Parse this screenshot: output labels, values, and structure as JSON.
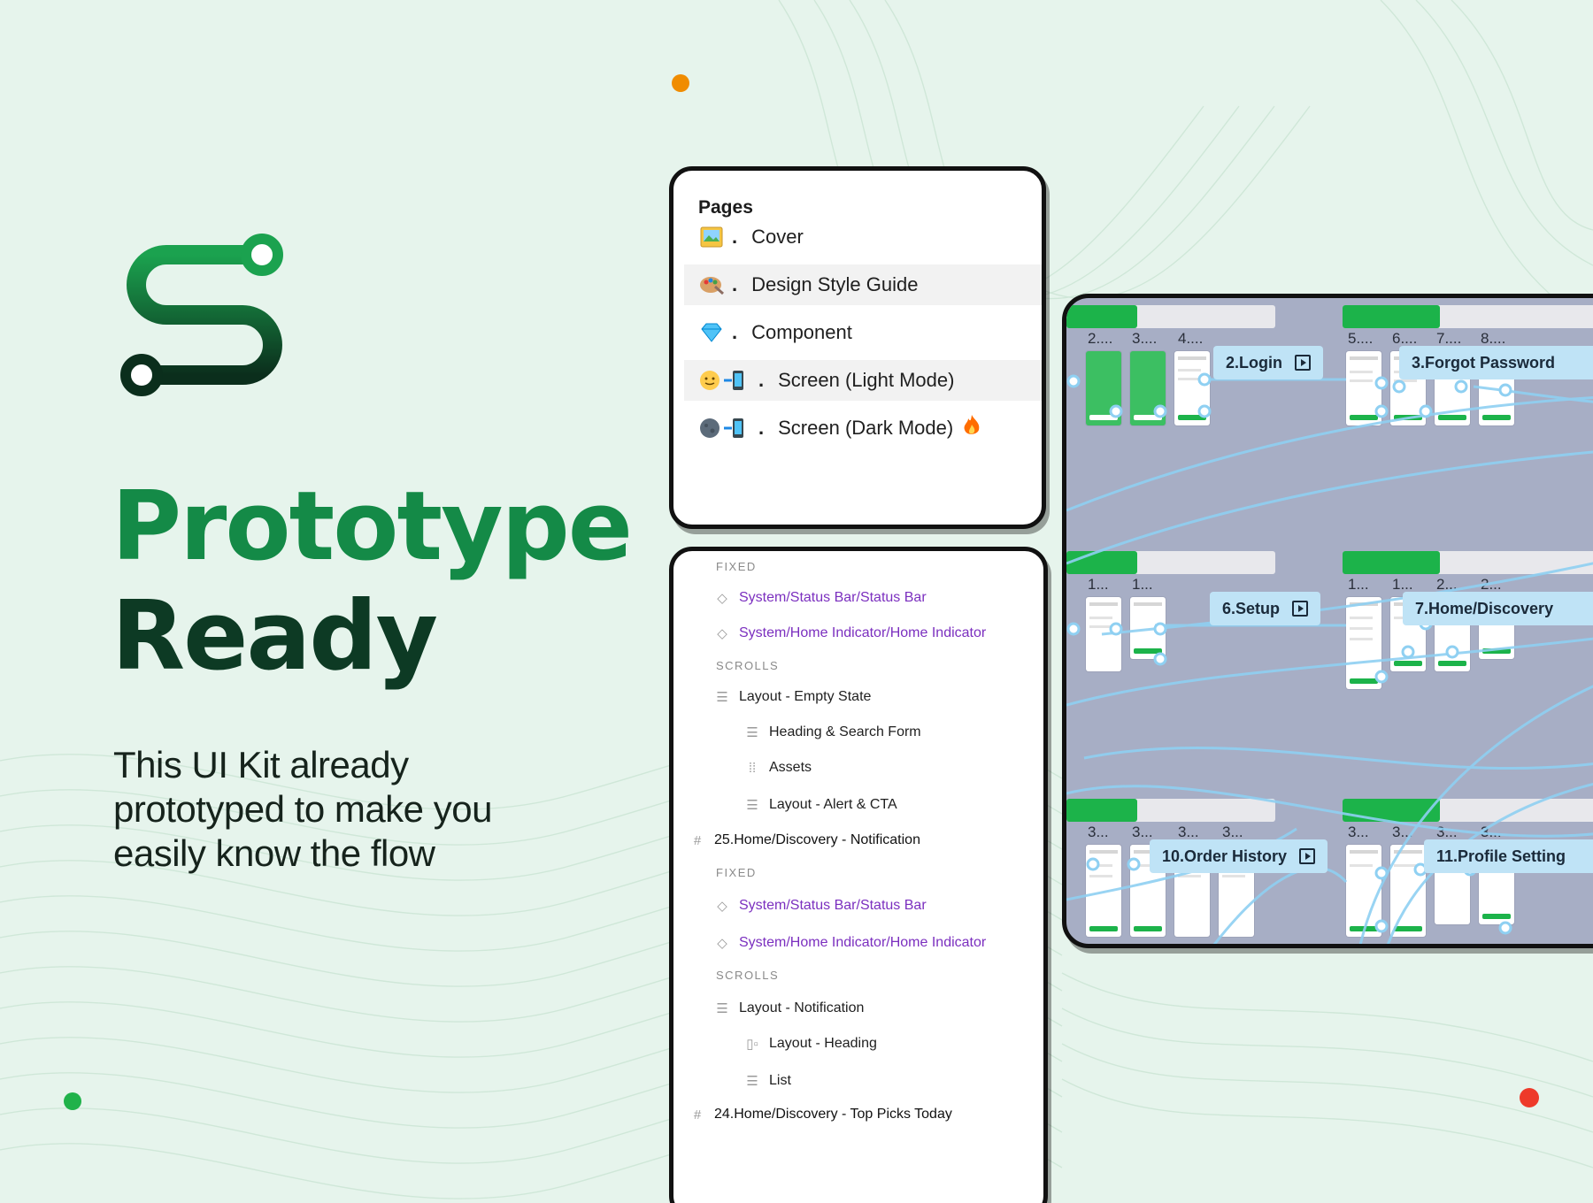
{
  "colors": {
    "background": "#e6f4ec",
    "title_green": "#148a47",
    "title_dark": "#0d3a24",
    "accent_orange": "#f08c00",
    "accent_red": "#ee3a2a",
    "accent_dot_green": "#20b24a",
    "component_purple": "#7b2fbf",
    "flow_label_bg": "#bfe3f6",
    "canvas_bg": "#a7aec5"
  },
  "hero": {
    "title_line1": "Prototype",
    "title_line2": "Ready",
    "subtitle": "This UI Kit already prototyped to make you easily know the flow"
  },
  "pages_panel": {
    "title": "Pages",
    "items": [
      {
        "icon": "picture-icon",
        "label": "Cover"
      },
      {
        "icon": "palette-icon",
        "label": "Design Style Guide"
      },
      {
        "icon": "diamond-icon",
        "label": "Component"
      },
      {
        "icon": "sun-phone-icon",
        "label": "Screen (Light Mode)"
      },
      {
        "icon": "moon-phone-icon",
        "label": "Screen (Dark Mode)"
      }
    ],
    "separator": "."
  },
  "layers_panel": {
    "rows": [
      {
        "type": "section",
        "label": "FIXED"
      },
      {
        "type": "comp",
        "icon": "component-diamond-icon",
        "label": "System/Status Bar/Status Bar"
      },
      {
        "type": "comp",
        "icon": "component-diamond-icon",
        "label": "System/Home Indicator/Home Indicator"
      },
      {
        "type": "section",
        "label": "SCROLLS"
      },
      {
        "type": "layer",
        "icon": "auto-layout-icon",
        "label": "Layout - Empty State"
      },
      {
        "type": "layer",
        "icon": "auto-layout-icon",
        "label": "Heading & Search Form"
      },
      {
        "type": "layer",
        "icon": "grid-layout-icon",
        "label": "Assets"
      },
      {
        "type": "layer",
        "icon": "auto-layout-icon",
        "label": "Layout - Alert & CTA"
      },
      {
        "type": "frame",
        "icon": "frame-hash-icon",
        "label": "25.Home/Discovery - Notification"
      },
      {
        "type": "section",
        "label": "FIXED"
      },
      {
        "type": "comp",
        "icon": "component-diamond-icon",
        "label": "System/Status Bar/Status Bar"
      },
      {
        "type": "comp",
        "icon": "component-diamond-icon",
        "label": "System/Home Indicator/Home Indicator"
      },
      {
        "type": "section",
        "label": "SCROLLS"
      },
      {
        "type": "layer",
        "icon": "auto-layout-icon",
        "label": "Layout - Notification"
      },
      {
        "type": "layer",
        "icon": "horizontal-layout-icon",
        "label": "Layout - Heading"
      },
      {
        "type": "layer",
        "icon": "auto-layout-icon",
        "label": "List"
      },
      {
        "type": "frame",
        "icon": "frame-hash-icon",
        "label": "24.Home/Discovery - Top Picks Today"
      }
    ]
  },
  "canvas": {
    "flows": [
      {
        "label": "2.Login"
      },
      {
        "label": "3.Forgot Password"
      },
      {
        "label": "6.Setup"
      },
      {
        "label": "7.Home/Discovery"
      },
      {
        "label": "10.Order History"
      },
      {
        "label": "11.Profile Setting"
      }
    ],
    "frame_numbers": {
      "row1": [
        "2....",
        "3....",
        "4....",
        "5....",
        "6....",
        "7....",
        "8...."
      ],
      "row2": [
        "1...",
        "1...",
        "1...",
        "1...",
        "2...",
        "2..."
      ],
      "row3": [
        "3...",
        "3...",
        "3...",
        "3...",
        "3...",
        "3...",
        "3...",
        "3..."
      ]
    }
  }
}
